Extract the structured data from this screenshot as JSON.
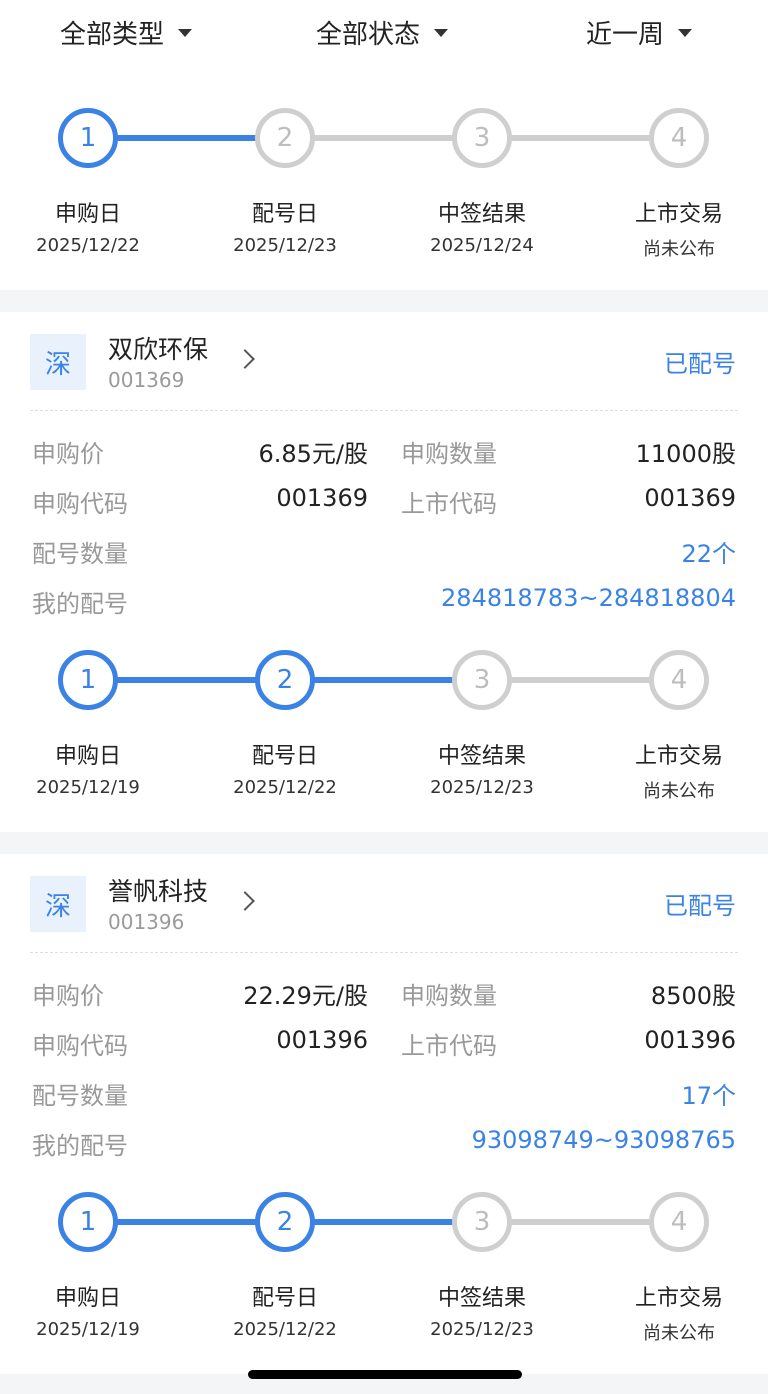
{
  "filters": {
    "type": "全部类型",
    "status": "全部状态",
    "period": "近一周"
  },
  "summary_steps": [
    {
      "num": "1",
      "label": "申购日",
      "date": "2025/12/22"
    },
    {
      "num": "2",
      "label": "配号日",
      "date": "2025/12/23"
    },
    {
      "num": "3",
      "label": "中签结果",
      "date": "2025/12/24"
    },
    {
      "num": "4",
      "label": "上市交易",
      "date": "尚未公布"
    }
  ],
  "labels": {
    "price": "申购价",
    "qty": "申购数量",
    "sub_code": "申购代码",
    "list_code": "上市代码",
    "alloc_count": "配号数量",
    "my_alloc": "我的配号"
  },
  "cards": [
    {
      "market": "深",
      "name": "双欣环保",
      "code": "001369",
      "status": "已配号",
      "price": "6.85元/股",
      "qty": "11000股",
      "sub_code": "001369",
      "list_code": "001369",
      "alloc_count": "22个",
      "my_alloc": "284818783~284818804",
      "steps": [
        {
          "num": "1",
          "label": "申购日",
          "date": "2025/12/19"
        },
        {
          "num": "2",
          "label": "配号日",
          "date": "2025/12/22"
        },
        {
          "num": "3",
          "label": "中签结果",
          "date": "2025/12/23"
        },
        {
          "num": "4",
          "label": "上市交易",
          "date": "尚未公布"
        }
      ]
    },
    {
      "market": "深",
      "name": "誉帆科技",
      "code": "001396",
      "status": "已配号",
      "price": "22.29元/股",
      "qty": "8500股",
      "sub_code": "001396",
      "list_code": "001396",
      "alloc_count": "17个",
      "my_alloc": "93098749~93098765",
      "steps": [
        {
          "num": "1",
          "label": "申购日",
          "date": "2025/12/19"
        },
        {
          "num": "2",
          "label": "配号日",
          "date": "2025/12/22"
        },
        {
          "num": "3",
          "label": "中签结果",
          "date": "2025/12/23"
        },
        {
          "num": "4",
          "label": "上市交易",
          "date": "尚未公布"
        }
      ]
    }
  ],
  "colors": {
    "accent": "#3a82e4",
    "inactive": "#cfcfcf"
  }
}
